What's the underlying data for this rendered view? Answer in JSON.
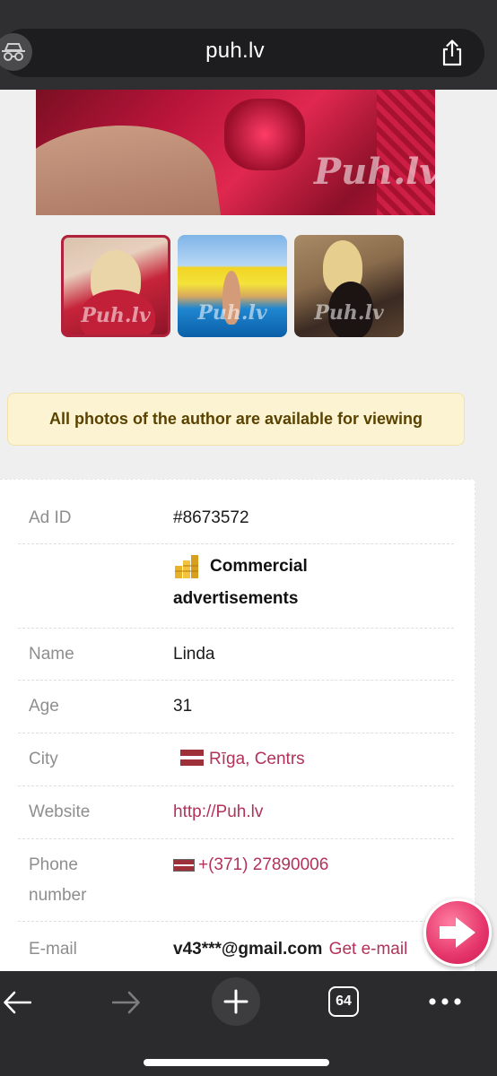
{
  "browser": {
    "url": "puh.lv",
    "tabs_count": "64"
  },
  "gallery": {
    "watermark": "Puh.lv"
  },
  "notice": {
    "text": "All photos of the author are available for viewing"
  },
  "details": {
    "ad_id_label": "Ad ID",
    "ad_id_value": "#8673572",
    "commercial_line1": "Commercial",
    "commercial_line2": "advertisements",
    "name_label": "Name",
    "name_value": "Linda",
    "age_label": "Age",
    "age_value": "31",
    "city_label": "City",
    "city_value": "Rīga, Centrs",
    "website_label": "Website",
    "website_value": "http://Puh.lv",
    "phone_label_line1": "Phone",
    "phone_label_line2": "number",
    "phone_value": "+(371) 27890006",
    "email_label": "E-mail",
    "email_value": "v43***@gmail.com",
    "email_link": "Get e-mail"
  },
  "icons": {
    "privacy": "incognito-icon",
    "share": "share-icon",
    "back": "arrow-left-icon",
    "forward": "arrow-right-icon",
    "new_tab": "plus-icon",
    "more": "ellipsis-icon",
    "next": "arrow-right-icon"
  },
  "colors": {
    "link": "#b2325a",
    "notice_bg": "#fbf3d2",
    "notice_text": "#5a4300",
    "fab": "#e5356a",
    "browser_chrome": "#2f2f31"
  }
}
